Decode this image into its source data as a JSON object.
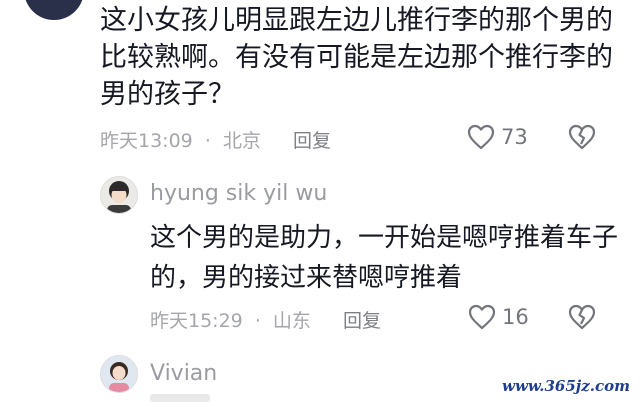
{
  "comment": {
    "text": "这小女孩儿明显跟左边儿推行李的那个男的比较熟啊。有没有可能是左边那个推行李的男的孩子？",
    "time": "昨天13:09",
    "location": "北京",
    "reply_label": "回复",
    "likes": "73"
  },
  "reply": {
    "username": "hyung sik yil wu",
    "text": "这个男的是助力，一开始是嗯哼推着车子的，男的接过来替嗯哼推着",
    "time": "昨天15:29",
    "location": "山东",
    "reply_label": "回复",
    "likes": "16"
  },
  "next_reply": {
    "username": "Vivian"
  },
  "separator": "·",
  "watermark": "www.365jz.com",
  "icons": {
    "like": "heart-outline-icon",
    "dislike": "broken-heart-icon"
  },
  "colors": {
    "text": "#161823",
    "meta": "#a4a6ab",
    "watermark": "#1f3f8e"
  }
}
